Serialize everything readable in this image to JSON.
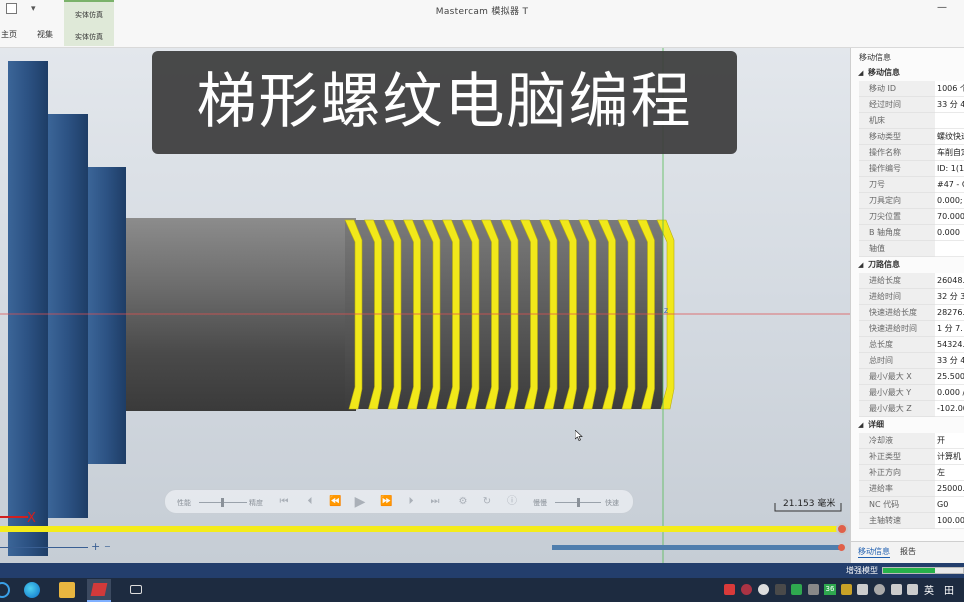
{
  "app": {
    "title": "Mastercam 模拟器  T",
    "minimize": "—"
  },
  "ribbon": {
    "quick_access": [
      "▾"
    ],
    "tabs": [
      "主页",
      "视集"
    ],
    "group_top": "实体仿真",
    "group_bottom": "实体仿真"
  },
  "overlay": {
    "banner": "梯形螺纹电脑编程"
  },
  "viewport": {
    "scale_label": "21.153 毫米",
    "axis_x_label": "X",
    "axis_z_label": "Z"
  },
  "playback": {
    "left_slider_start": "性能",
    "left_slider_end": "精度",
    "right_slider_start": "慢慢",
    "right_slider_end": "快速",
    "buttons": [
      "jump-start",
      "step-back",
      "rewind",
      "play",
      "forward",
      "step-forward",
      "jump-end",
      "options",
      "loop",
      "info"
    ]
  },
  "timeline": {
    "plus": "+",
    "minus": "−"
  },
  "panel": {
    "title": "移动信息",
    "sections": [
      {
        "label": "移动信息",
        "rows": [
          {
            "key": "移动 ID",
            "value": "1006 个"
          },
          {
            "key": "经过时间",
            "value": "33 分 4"
          },
          {
            "key": "机床",
            "value": ""
          },
          {
            "key": "移动类型",
            "value": "螺纹快速"
          },
          {
            "key": "操作名称",
            "value": "车削自定"
          },
          {
            "key": "操作编号",
            "value": "ID: 1(1"
          },
          {
            "key": "刀号",
            "value": "#47 - C"
          },
          {
            "key": "刀具定向",
            "value": "0.000;"
          },
          {
            "key": "刀尖位置",
            "value": "70.000;"
          },
          {
            "key": "B 轴角度",
            "value": "0.000"
          },
          {
            "key": "轴值",
            "value": ""
          }
        ]
      },
      {
        "label": "刀路信息",
        "rows": [
          {
            "key": "进给长度",
            "value": "26048."
          },
          {
            "key": "进给时间",
            "value": "32 分 3"
          },
          {
            "key": "快速进给长度",
            "value": "28276."
          },
          {
            "key": "快速进给时间",
            "value": "1 分 7."
          },
          {
            "key": "总长度",
            "value": "54324."
          },
          {
            "key": "总时间",
            "value": "33 分 4"
          },
          {
            "key": "最小/最大 X",
            "value": "25.500"
          },
          {
            "key": "最小/最大 Y",
            "value": "0.000 /"
          },
          {
            "key": "最小/最大 Z",
            "value": "-102.00"
          }
        ]
      },
      {
        "label": "详细",
        "rows": [
          {
            "key": "冷却液",
            "value": "开"
          },
          {
            "key": "补正类型",
            "value": "计算机"
          },
          {
            "key": "补正方向",
            "value": "左"
          },
          {
            "key": "进给率",
            "value": "25000."
          },
          {
            "key": "NC 代码",
            "value": "G0"
          },
          {
            "key": "主轴转速",
            "value": "100.000"
          }
        ]
      }
    ],
    "tabs": [
      "移动信息",
      "报告"
    ]
  },
  "statusbar": {
    "label": "增强模型",
    "progress": 0.65
  },
  "taskbar": {
    "tray_badge": "36",
    "ime": "英",
    "ime2": "田"
  },
  "colors": {
    "thread": "#f1e81a",
    "shaft": "#6d6d6d",
    "chuck": "#2e5686",
    "accent": "#27b24a"
  }
}
